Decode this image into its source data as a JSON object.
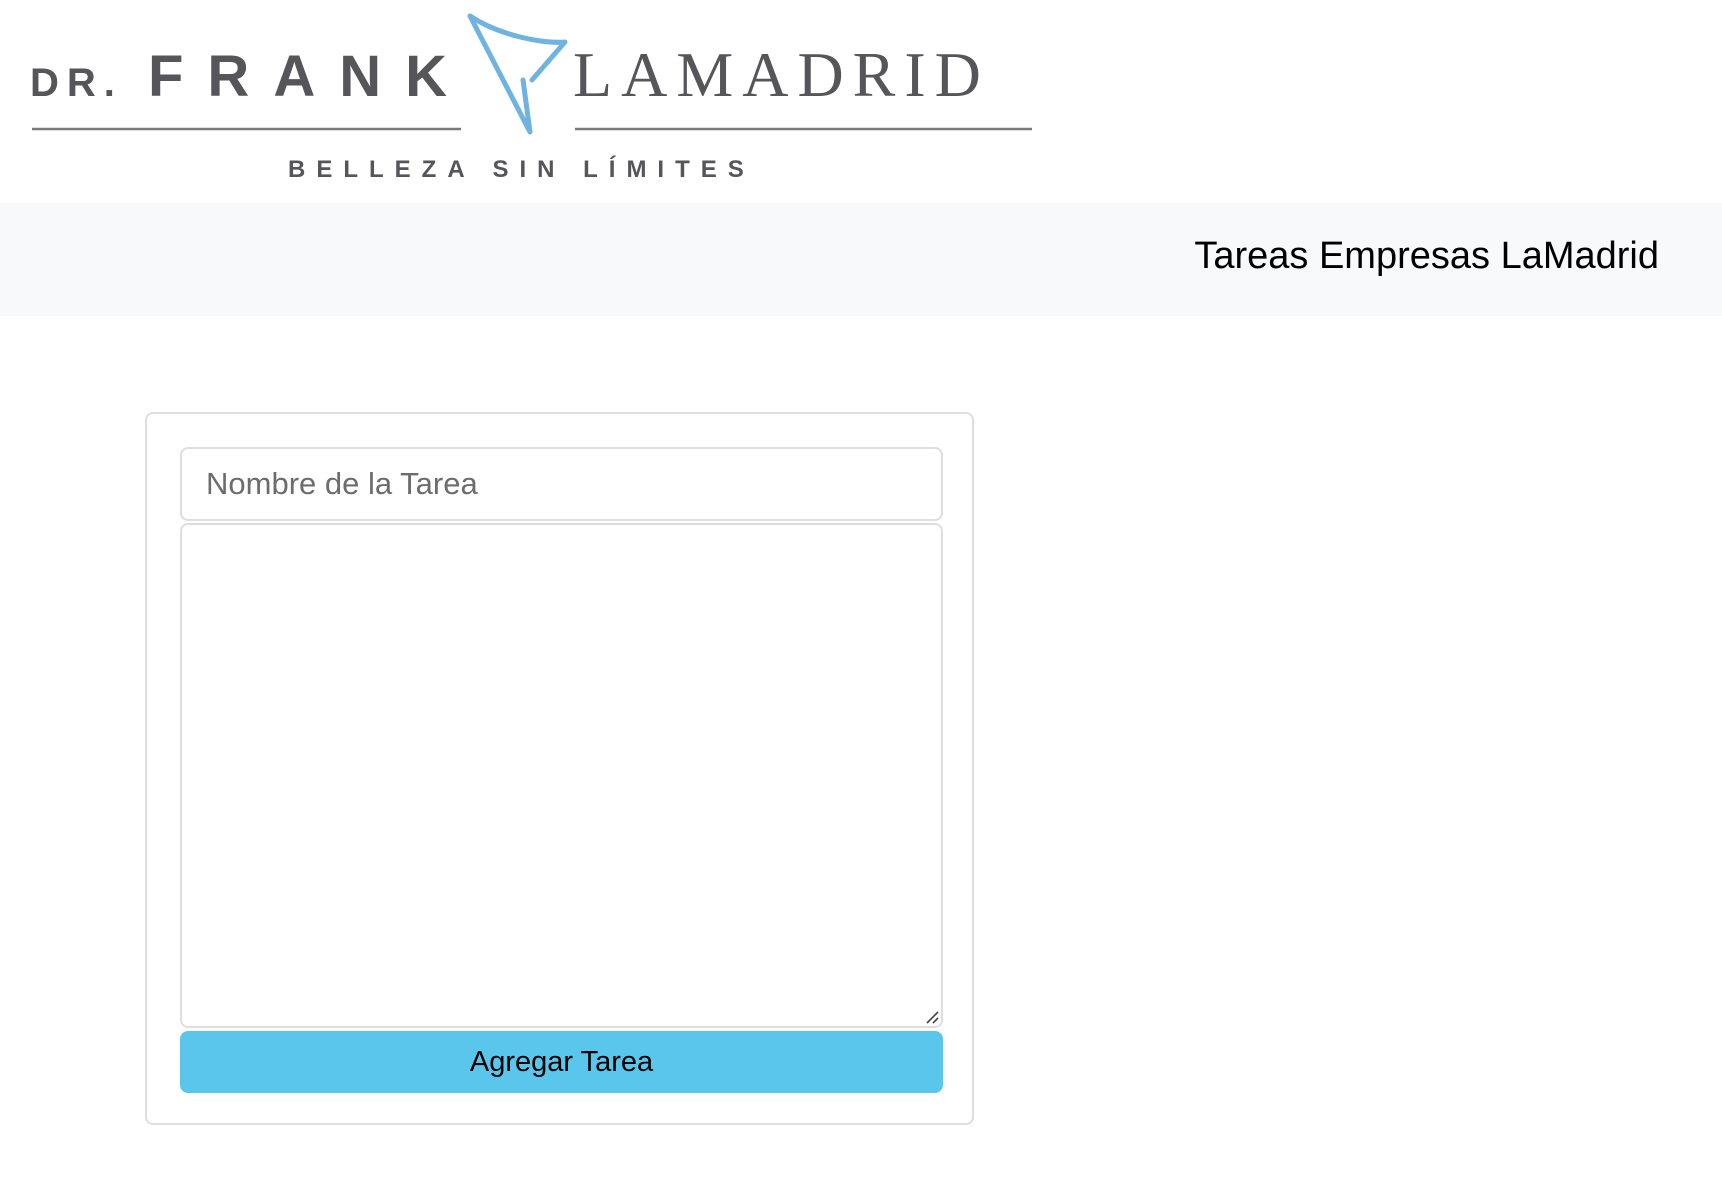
{
  "brand": {
    "logo_prefix": "DR.",
    "logo_first_name": "FRANK",
    "logo_last_name": "LAMADRID",
    "logo_tagline": "BELLEZA SIN LÍMITES",
    "logo_text_color": "#55555a",
    "logo_accent_color": "#6fb3e0"
  },
  "navbar": {
    "title": "Tareas Empresas LaMadrid",
    "background_color": "#f8f9fa"
  },
  "form": {
    "task_name": {
      "value": "",
      "placeholder": "Nombre de la Tarea"
    },
    "task_description": {
      "value": ""
    },
    "submit_label": "Agregar Tarea",
    "submit_color": "#5bc6eb"
  }
}
